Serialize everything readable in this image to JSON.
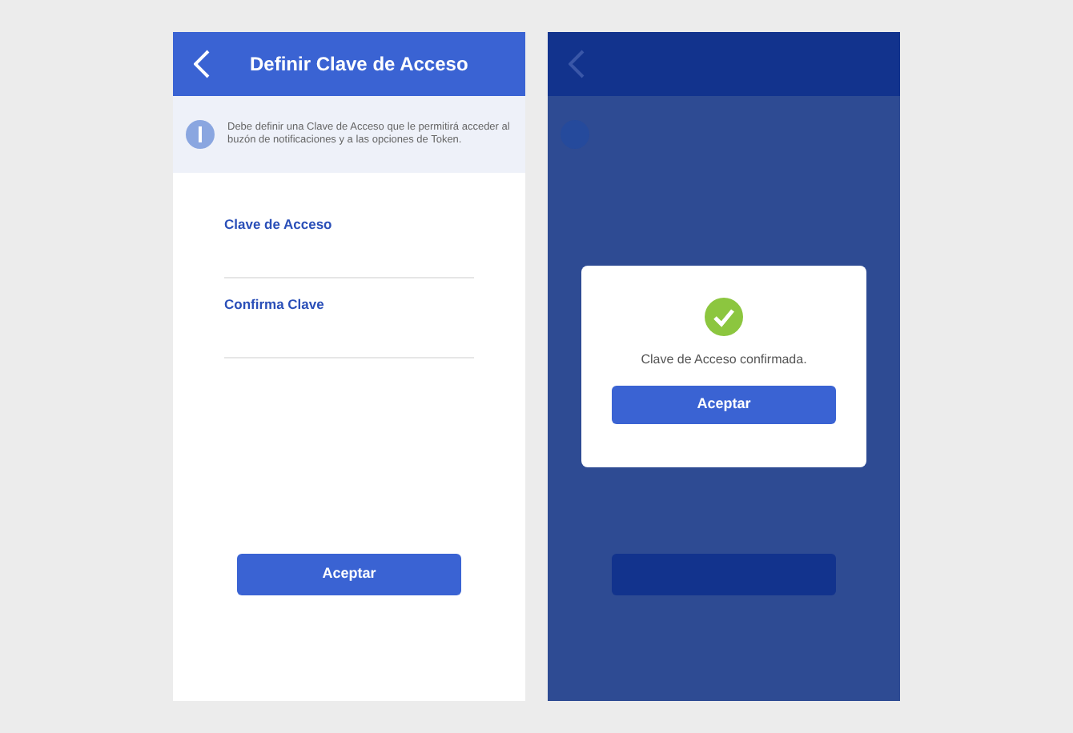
{
  "form_screen": {
    "title": "Definir Clave de Acceso",
    "notice": "Debe definir una Clave de Acceso que le permitirá acceder al buzón de notificaciones y a las opciones de Token.",
    "fields": [
      {
        "label": "Clave de Acceso"
      },
      {
        "label": "Confirma Clave"
      }
    ],
    "button": "Aceptar"
  },
  "confirmation_screen": {
    "dialog": {
      "message": "Clave de Acceso confirmada.",
      "button": "Aceptar"
    }
  }
}
